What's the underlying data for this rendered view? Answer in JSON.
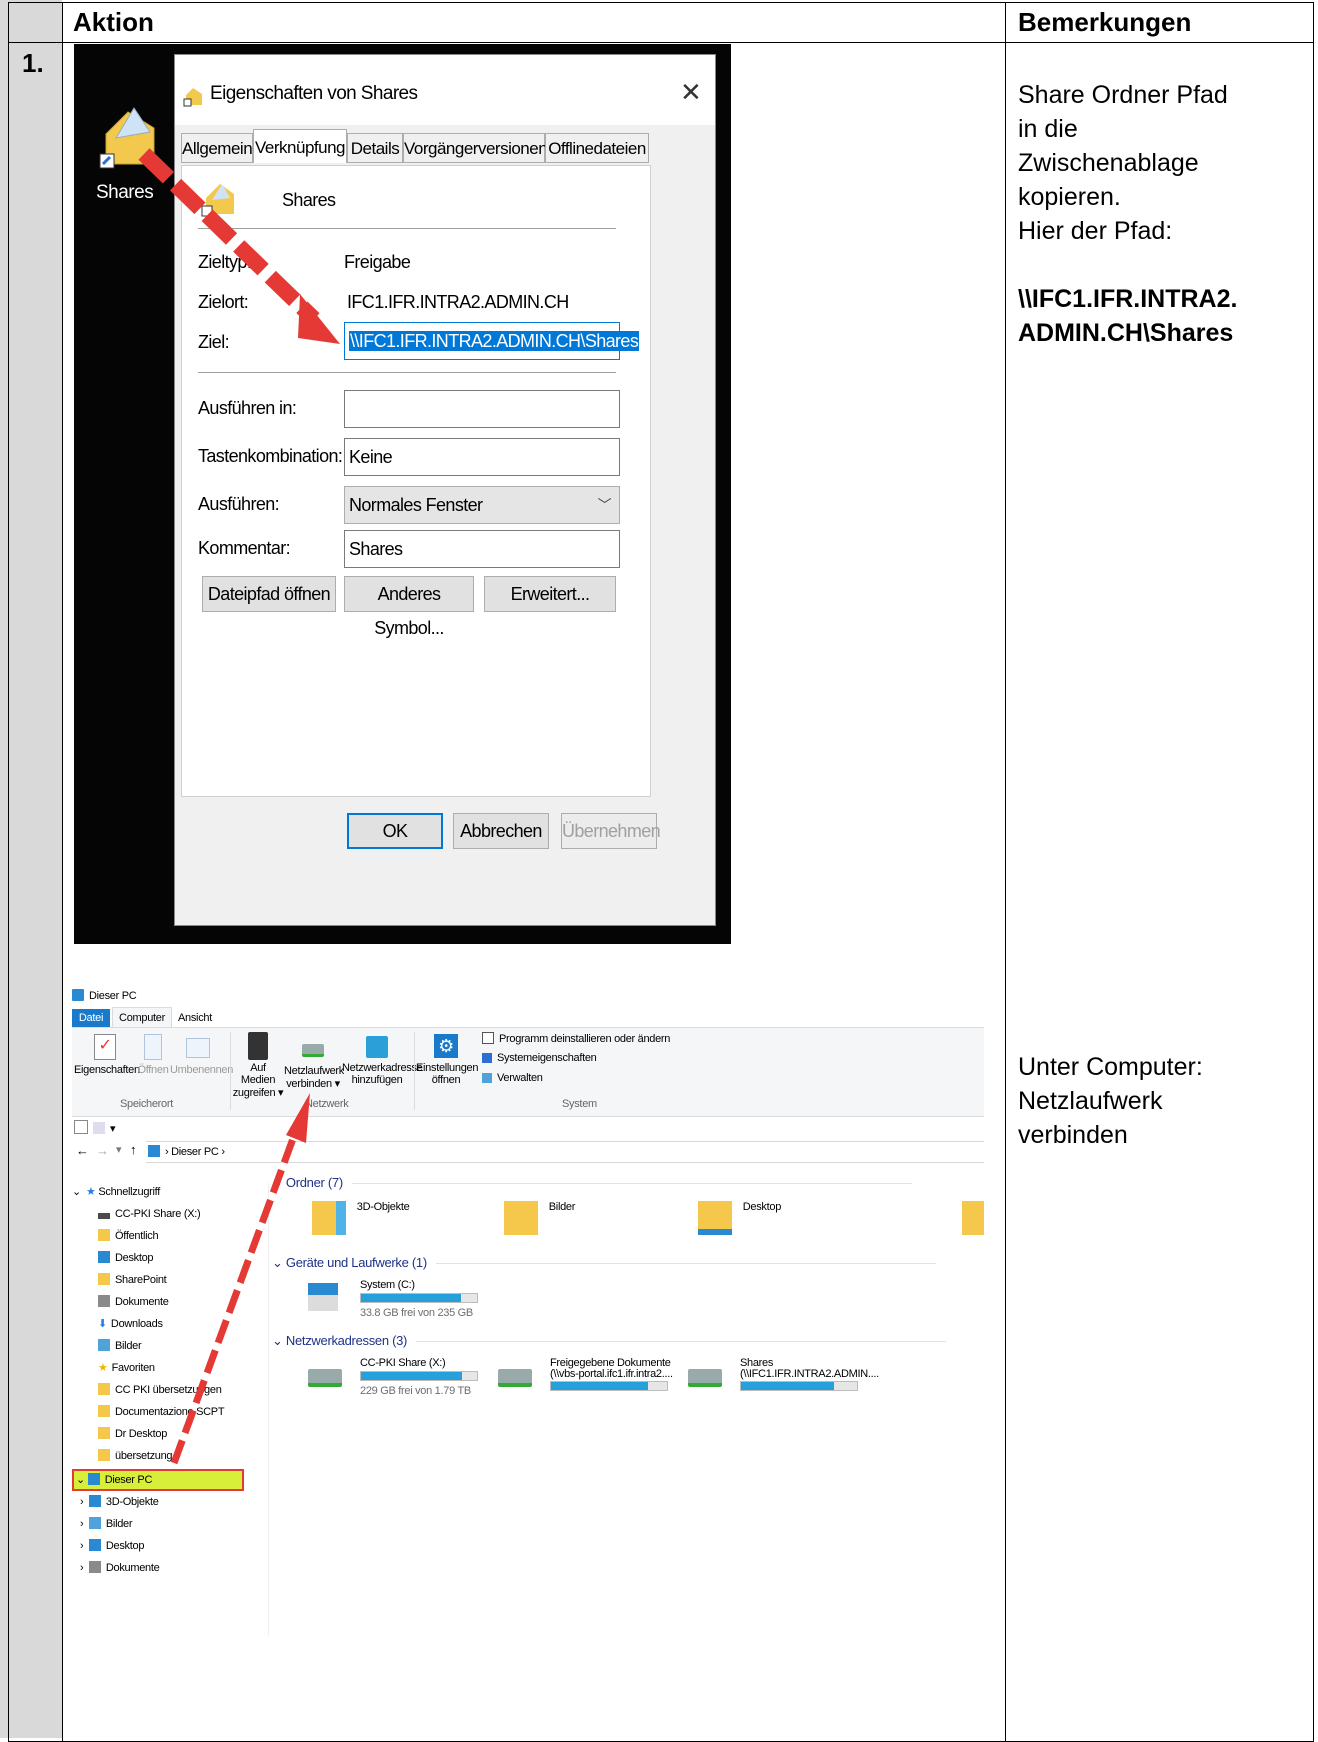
{
  "table": {
    "header_action": "Aktion",
    "header_remarks": "Bemerkungen",
    "step_number": "1."
  },
  "remarks": {
    "step1_line1": "Share Ordner Pfad",
    "step1_line2": "in die",
    "step1_line3": "Zwischenablage",
    "step1_line4": "kopieren.",
    "step1_line5": "Hier der Pfad:",
    "path_line1": "\\\\IFC1.IFR.INTRA2.",
    "path_line2": "ADMIN.CH\\Shares",
    "step2_line1": "Unter Computer:",
    "step2_line2": "Netzlaufwerk",
    "step2_line3": "verbinden"
  },
  "desktop": {
    "icon_label": "Shares"
  },
  "dialog": {
    "title": "Eigenschaften von Shares",
    "tabs": [
      "Allgemein",
      "Verknüpfung",
      "Details",
      "Vorgängerversionen",
      "Offlinedateien"
    ],
    "active_tab": "Verknüpfung",
    "name": "Shares",
    "zieltyp_label": "Zieltyp:",
    "zieltyp_value": "Freigabe",
    "zielort_label": "Zielort:",
    "zielort_value": "IFC1.IFR.INTRA2.ADMIN.CH",
    "ziel_label": "Ziel:",
    "ziel_value": "\\\\IFC1.IFR.INTRA2.ADMIN.CH\\Shares",
    "ausfuehren_in_label": "Ausführen in:",
    "ausfuehren_in_value": "",
    "tastenkombination_label": "Tastenkombination:",
    "tastenkombination_value": "Keine",
    "ausfuehren_label": "Ausführen:",
    "ausfuehren_value": "Normales Fenster",
    "kommentar_label": "Kommentar:",
    "kommentar_value": "Shares",
    "btn_dateipfad": "Dateipfad öffnen",
    "btn_symbol": "Anderes Symbol...",
    "btn_erweitert": "Erweitert...",
    "btn_ok": "OK",
    "btn_abbrechen": "Abbrechen",
    "btn_uebernehmen": "Übernehmen"
  },
  "explorer": {
    "title": "Dieser PC",
    "ribbon_tabs": [
      "Datei",
      "Computer",
      "Ansicht"
    ],
    "ribbon": {
      "eigenschaften": "Eigenschaften",
      "oeffnen": "Öffnen",
      "umbenennen": "Umbenennen",
      "speicherort": "Speicherort",
      "auf_medien_1": "Auf Medien",
      "auf_medien_2": "zugreifen ▾",
      "netzlaufwerk_1": "Netzlaufwerk",
      "netzlaufwerk_2": "verbinden ▾",
      "netzwerkadresse_1": "Netzwerkadresse",
      "netzwerkadresse_2": "hinzufügen",
      "netzwerk": "Netzwerk",
      "einstellungen_1": "Einstellungen",
      "einstellungen_2": "öffnen",
      "programm": "Programm deinstallieren oder ändern",
      "systemeigenschaften": "Systemeigenschaften",
      "verwalten": "Verwalten",
      "system": "System"
    },
    "address": "Dieser PC",
    "nav": [
      {
        "label": "Schnellzugriff",
        "color": "#2a7de1"
      },
      {
        "label": "CC-PKI Share (X:)",
        "color": "#4b4b4b"
      },
      {
        "label": "Öffentlich",
        "color": "#f5c84c"
      },
      {
        "label": "Desktop",
        "color": "#2a8ad1"
      },
      {
        "label": "SharePoint",
        "color": "#f5c84c"
      },
      {
        "label": "Dokumente",
        "color": "#8a8a8a"
      },
      {
        "label": "Downloads",
        "color": "#2a7de1"
      },
      {
        "label": "Bilder",
        "color": "#4fa3d9"
      },
      {
        "label": "Favoriten",
        "color": "#f0b400"
      },
      {
        "label": "CC PKI übersetzungen",
        "color": "#f5c84c"
      },
      {
        "label": "Documentazione SCPT",
        "color": "#f5c84c"
      },
      {
        "label": "Dr Desktop",
        "color": "#f5c84c"
      },
      {
        "label": "übersetzung",
        "color": "#f5c84c"
      },
      {
        "label": "Dieser PC",
        "color": "#2a8ad1"
      },
      {
        "label": "3D-Objekte",
        "color": "#2a8ad1"
      },
      {
        "label": "Bilder",
        "color": "#4fa3d9"
      },
      {
        "label": "Desktop",
        "color": "#2a8ad1"
      },
      {
        "label": "Dokumente",
        "color": "#8a8a8a"
      }
    ],
    "ordner_header": "Ordner (7)",
    "folders": [
      "3D-Objekte",
      "Bilder",
      "Desktop"
    ],
    "geraete_header": "Geräte und Laufwerke (1)",
    "drive_c_name": "System (C:)",
    "drive_c_free": "33.8 GB frei von 235 GB",
    "drive_c_fill": 0.86,
    "netz_header": "Netzwerkadressen (3)",
    "net1_name": "CC-PKI Share (X:)",
    "net1_free": "229 GB frei von 1.79 TB",
    "net1_fill": 0.87,
    "net2_name": "Freigegebene Dokumente",
    "net2_path": "(\\\\vbs-portal.ifc1.ifr.intra2....",
    "net2_fill": 0.84,
    "net3_name": "Shares",
    "net3_path": "(\\\\IFC1.IFR.INTRA2.ADMIN....",
    "net3_fill": 0.8
  },
  "colors": {
    "accent": "#26a0da",
    "arrow_red": "#e53935",
    "highlight_yellow": "#d8ef3a"
  }
}
